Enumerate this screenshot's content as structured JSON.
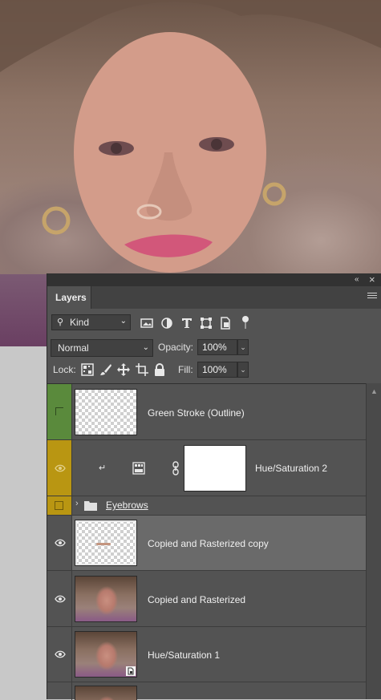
{
  "colors": {
    "panel_bg": "#535353",
    "selected_row": "#6a6a6a",
    "green_label": "#5a8a3c",
    "yellow_label": "#b99612",
    "text": "#f0f0f0"
  },
  "panel": {
    "tab_label": "Layers",
    "collapse_glyph": "«",
    "close_glyph": "×"
  },
  "filter": {
    "kind_label": "Kind",
    "icons": [
      "image-filter-icon",
      "adjustment-filter-icon",
      "type-filter-icon",
      "shape-filter-icon",
      "smart-object-filter-icon",
      "filter-toggle-icon"
    ]
  },
  "blend": {
    "mode": "Normal",
    "opacity_label": "Opacity:",
    "opacity_value": "100%",
    "lock_label": "Lock:",
    "fill_label": "Fill:",
    "fill_value": "100%"
  },
  "layers": [
    {
      "name": "Green Stroke (Outline)",
      "visible": false,
      "label_color": "green"
    },
    {
      "name": "Hue/Saturation 2",
      "visible": true,
      "label_color": "yellow",
      "clipped": true
    },
    {
      "name": "Eyebrows",
      "type": "group",
      "visible": false,
      "label_color": "yellow"
    },
    {
      "name": "Copied and Rasterized copy",
      "visible": true,
      "selected": true
    },
    {
      "name": "Copied and Rasterized",
      "visible": true
    },
    {
      "name": "Hue/Saturation 1",
      "visible": true,
      "smart_object": true
    }
  ]
}
